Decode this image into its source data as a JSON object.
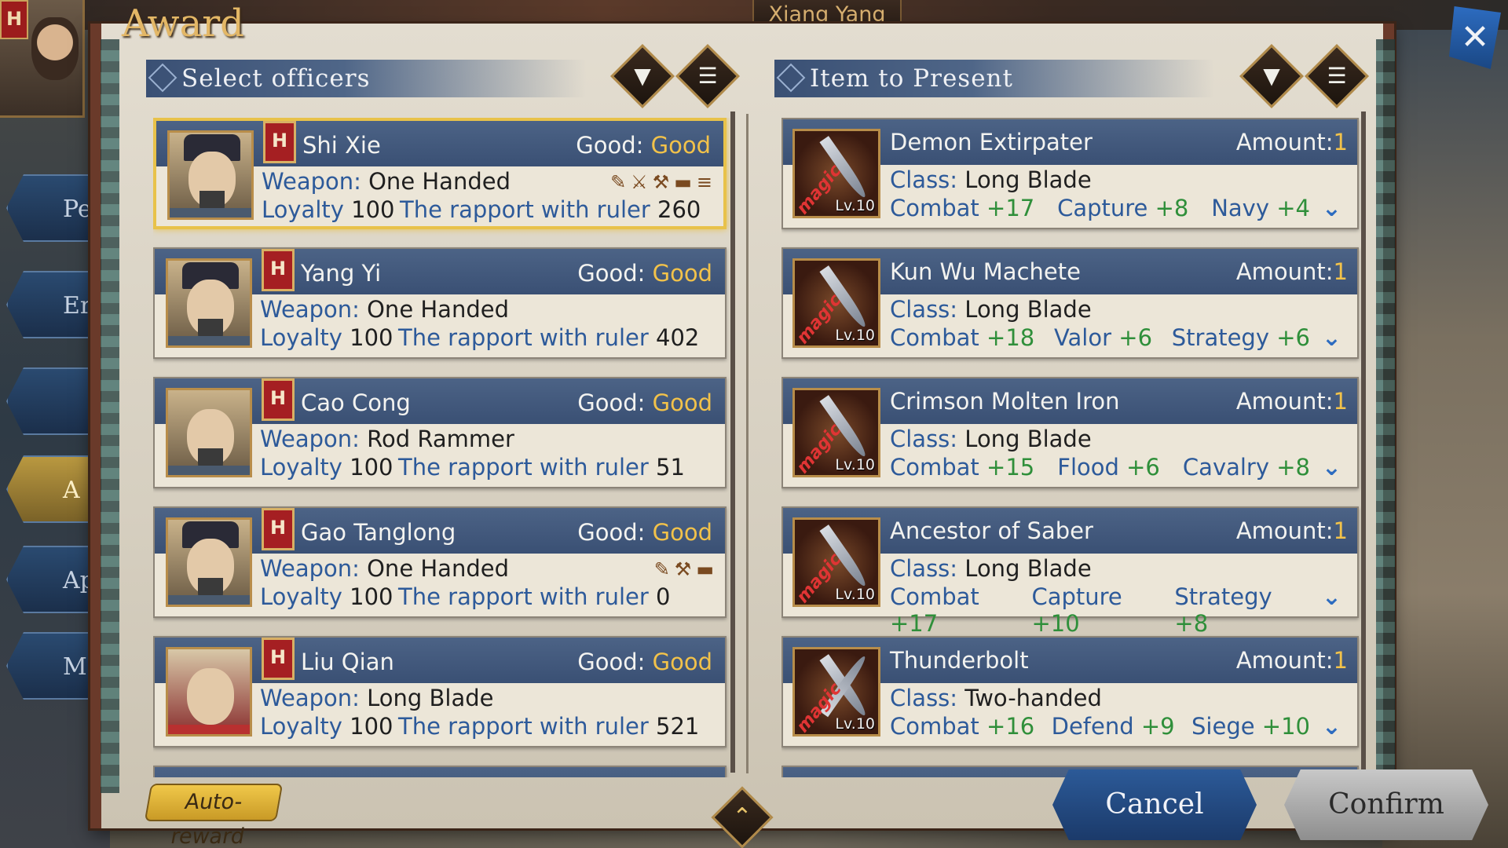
{
  "top": {
    "city": "Xiang Yang",
    "ruler_badge": "H"
  },
  "side_tabs": [
    "Pe",
    "Er",
    "",
    "A",
    "Ap",
    "M"
  ],
  "dialog": {
    "title": "Award",
    "left_header": "Select officers",
    "right_header": "Item to Present",
    "auto_reward": "Auto-reward",
    "cancel": "Cancel",
    "confirm": "Confirm"
  },
  "labels": {
    "good": "Good: ",
    "weapon": "Weapon: ",
    "loyalty": "Loyalty ",
    "rapport": "The rapport with ruler ",
    "amount": "Amount:",
    "class": "Class: ",
    "magic": "magic",
    "level": "Lv.10",
    "badge": "H"
  },
  "officers": [
    {
      "name": "Shi Xie",
      "good": "Good",
      "weapon": "One Handed",
      "loyalty": "100",
      "rapport": "260",
      "selected": true,
      "equip": [
        "✎",
        "⚔",
        "⚒",
        "▬",
        "≡"
      ]
    },
    {
      "name": "Yang Yi",
      "good": "Good",
      "weapon": "One Handed",
      "loyalty": "100",
      "rapport": "402",
      "selected": false,
      "equip": []
    },
    {
      "name": "Cao Cong",
      "good": "Good",
      "weapon": "Rod Rammer",
      "loyalty": "100",
      "rapport": "51",
      "selected": false,
      "equip": []
    },
    {
      "name": "Gao Tanglong",
      "good": "Good",
      "weapon": "One Handed",
      "loyalty": "100",
      "rapport": "0",
      "selected": false,
      "equip": [
        "✎",
        "⚒",
        "▬"
      ]
    },
    {
      "name": "Liu Qian",
      "good": "Good",
      "weapon": "Long Blade",
      "loyalty": "100",
      "rapport": "521",
      "selected": false,
      "equip": []
    }
  ],
  "items": [
    {
      "name": "Demon Extirpater",
      "amount": "1",
      "class": "Long Blade",
      "stats": [
        [
          "Combat",
          "+17"
        ],
        [
          "Capture",
          "+8"
        ],
        [
          "Navy",
          "+4"
        ]
      ],
      "crossed": false
    },
    {
      "name": "Kun Wu Machete",
      "amount": "1",
      "class": "Long Blade",
      "stats": [
        [
          "Combat",
          "+18"
        ],
        [
          "Valor",
          "+6"
        ],
        [
          "Strategy",
          "+6"
        ]
      ],
      "crossed": false
    },
    {
      "name": "Crimson Molten Iron",
      "amount": "1",
      "class": "Long Blade",
      "stats": [
        [
          "Combat",
          "+15"
        ],
        [
          "Flood",
          "+6"
        ],
        [
          "Cavalry",
          "+8"
        ]
      ],
      "crossed": false
    },
    {
      "name": "Ancestor of Saber",
      "amount": "1",
      "class": "Long Blade",
      "stats": [
        [
          "Combat",
          "+17"
        ],
        [
          "Capture",
          "+10"
        ],
        [
          "Strategy",
          "+8"
        ]
      ],
      "crossed": false
    },
    {
      "name": "Thunderbolt",
      "amount": "1",
      "class": "Two-handed",
      "stats": [
        [
          "Combat",
          "+16"
        ],
        [
          "Defend",
          "+9"
        ],
        [
          "Siege",
          "+10"
        ]
      ],
      "crossed": true
    }
  ],
  "colors": {
    "accent_gold": "#f2c24a",
    "header_blue": "#3a5074",
    "label_blue": "#2d5a9a",
    "stat_green": "#2f8f3a",
    "badge_red": "#a51f22"
  }
}
